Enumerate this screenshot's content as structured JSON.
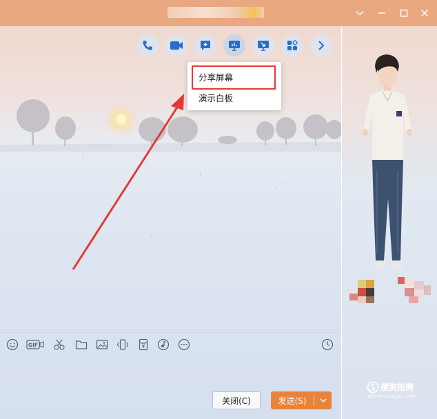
{
  "popup": {
    "items": [
      {
        "label": "分享屏幕"
      },
      {
        "label": "演示白板"
      }
    ]
  },
  "bottom": {
    "close_label": "关闭(C)",
    "send_label": "发送(S)"
  },
  "watermark": {
    "brand": "搜狗指南",
    "url": "zhinan.sogou.com"
  },
  "colors": {
    "titlebar": "#e9a87f",
    "icon_blue": "#2c6cc9",
    "send_button": "#e8833a",
    "highlight_box": "#e53935",
    "arrow": "#e53935"
  },
  "toolbar_icons": [
    "phone-icon",
    "video-icon",
    "add-chat-icon",
    "share-screen-icon",
    "remote-desktop-icon",
    "apps-icon",
    "chevron-right-icon"
  ],
  "input_toolbar_icons": [
    "emoji-icon",
    "gif-icon",
    "scissors-icon",
    "folder-icon",
    "image-icon",
    "shake-icon",
    "red-packet-icon",
    "music-icon",
    "more-icon",
    "history-clock-icon"
  ]
}
